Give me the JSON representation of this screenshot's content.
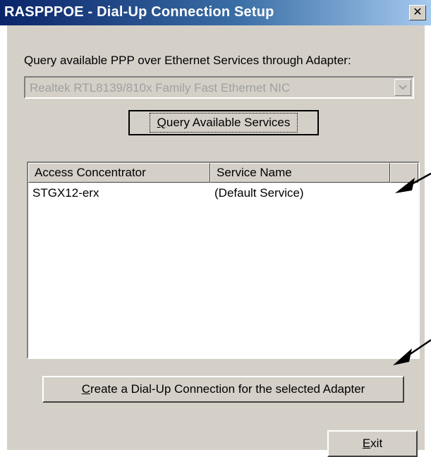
{
  "window": {
    "title": "RASPPPOE - Dial-Up Connection Setup",
    "close_glyph": "✕"
  },
  "query": {
    "label": "Query available PPP over Ethernet Services through Adapter:",
    "adapter_selected": "Realtek RTL8139/810x Family Fast Ethernet NIC",
    "button_hotkey": "Q",
    "button_rest": "uery Available Services"
  },
  "services": {
    "columns": [
      "Access Concentrator",
      "Service Name",
      ""
    ],
    "rows": [
      {
        "access_concentrator": "STGX12-erx",
        "service_name": "(Default Service)"
      }
    ]
  },
  "actions": {
    "create_hotkey": "C",
    "create_rest": "reate a Dial-Up Connection for the selected Adapter",
    "exit_hotkey": "E",
    "exit_rest": "xit"
  },
  "colors": {
    "title_start": "#0a246a",
    "title_end": "#a6caf0",
    "face": "#d4d0c8"
  },
  "icons": [
    "close-icon",
    "chevron-down-icon",
    "annotation-arrow"
  ]
}
